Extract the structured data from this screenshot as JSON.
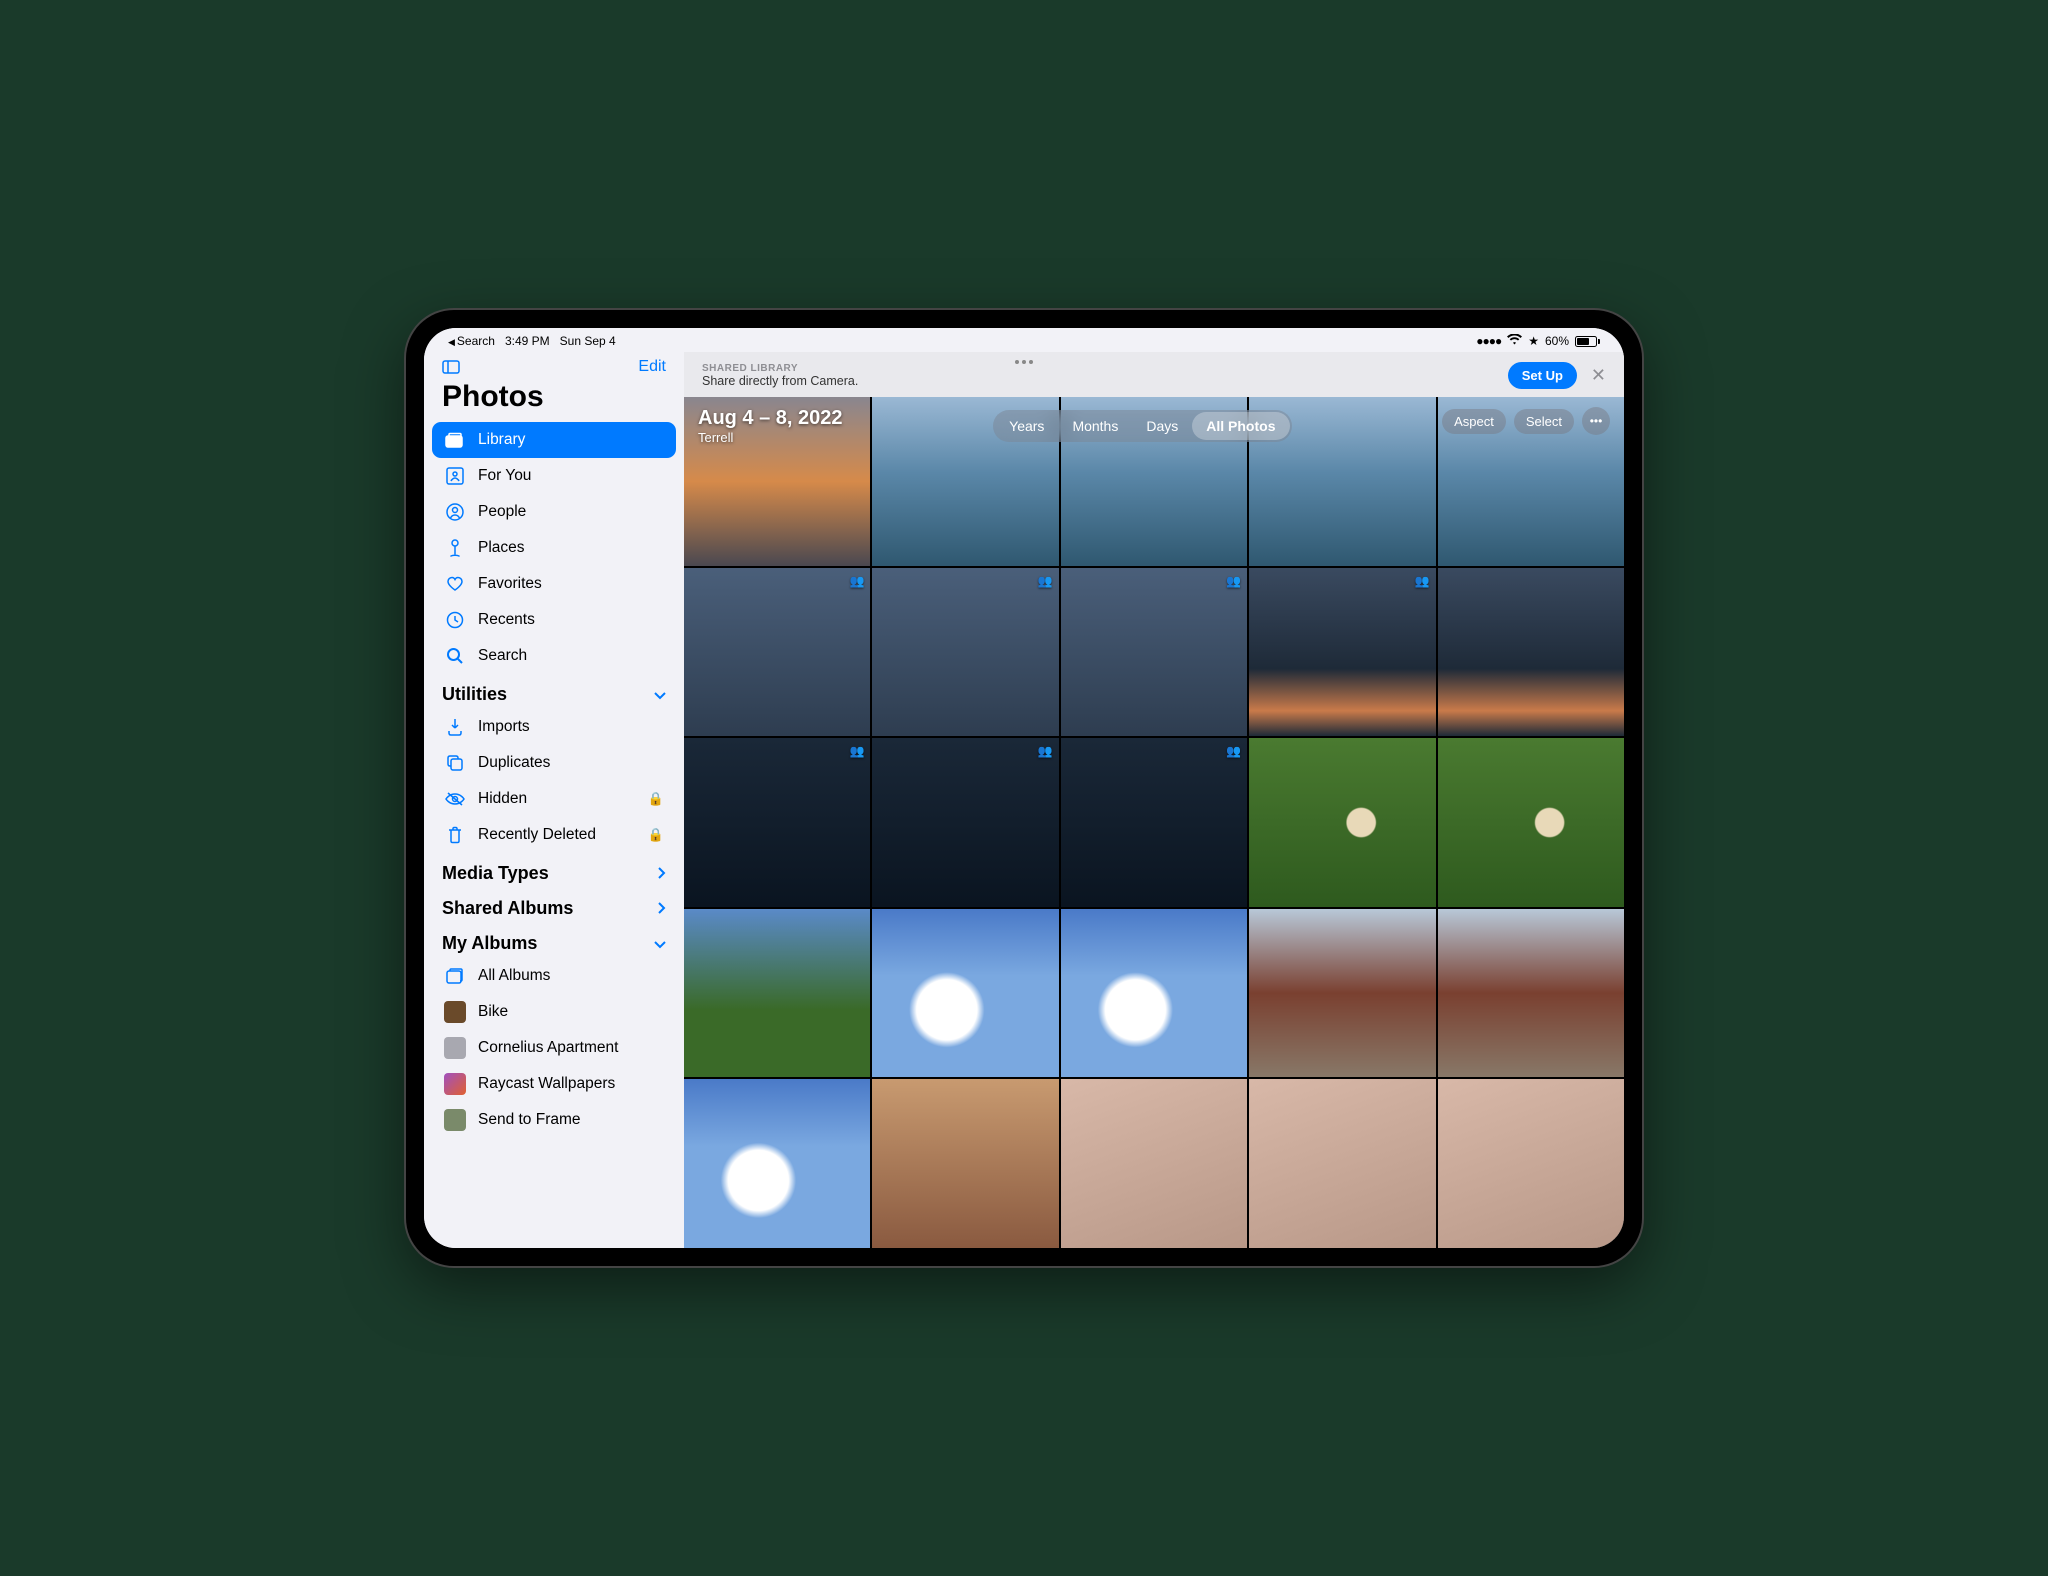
{
  "status": {
    "back": "Search",
    "time": "3:49 PM",
    "date": "Sun Sep 4",
    "battery": "60%"
  },
  "sidebar": {
    "edit": "Edit",
    "title": "Photos",
    "primary": [
      {
        "label": "Library",
        "icon": "library"
      },
      {
        "label": "For You",
        "icon": "foryou"
      },
      {
        "label": "People",
        "icon": "people"
      },
      {
        "label": "Places",
        "icon": "places"
      },
      {
        "label": "Favorites",
        "icon": "heart"
      },
      {
        "label": "Recents",
        "icon": "clock"
      },
      {
        "label": "Search",
        "icon": "search"
      }
    ],
    "sections": {
      "utilities": {
        "label": "Utilities",
        "items": [
          {
            "label": "Imports",
            "icon": "download",
            "locked": false
          },
          {
            "label": "Duplicates",
            "icon": "duplicate",
            "locked": false
          },
          {
            "label": "Hidden",
            "icon": "hidden",
            "locked": true
          },
          {
            "label": "Recently Deleted",
            "icon": "trash",
            "locked": true
          }
        ]
      },
      "media_types": {
        "label": "Media Types"
      },
      "shared_albums": {
        "label": "Shared Albums"
      },
      "my_albums": {
        "label": "My Albums",
        "items": [
          {
            "label": "All Albums",
            "icon": "albums"
          },
          {
            "label": "Bike",
            "thumb": "#6a4a2a"
          },
          {
            "label": "Cornelius Apartment",
            "thumb": "#a8a8b0"
          },
          {
            "label": "Raycast Wallpapers",
            "thumb": "linear-gradient(135deg,#a050c0,#e06030)"
          },
          {
            "label": "Send to Frame",
            "thumb": "#7a8a6a"
          }
        ]
      }
    }
  },
  "banner": {
    "label": "SHARED LIBRARY",
    "desc": "Share directly from Camera.",
    "button": "Set Up"
  },
  "header": {
    "date_range": "Aug 4 – 8, 2022",
    "location": "Terrell",
    "segments": [
      "Years",
      "Months",
      "Days",
      "All Photos"
    ],
    "active_segment": 3,
    "aspect": "Aspect",
    "select": "Select"
  },
  "grid": {
    "shared_badge": "👥",
    "rows": [
      [
        "sunset",
        "lake",
        "lake",
        "lake",
        "lake"
      ],
      [
        "dusk s",
        "dusk s",
        "dusk s",
        "dusk2 s",
        "dusk2"
      ],
      [
        "night s",
        "night s",
        "night s",
        "grass",
        "grass"
      ],
      [
        "park",
        "clouds",
        "clouds",
        "bridge",
        "bridge"
      ],
      [
        "clouds",
        "screenshot",
        "pastel",
        "pastel",
        "pastel"
      ]
    ]
  }
}
